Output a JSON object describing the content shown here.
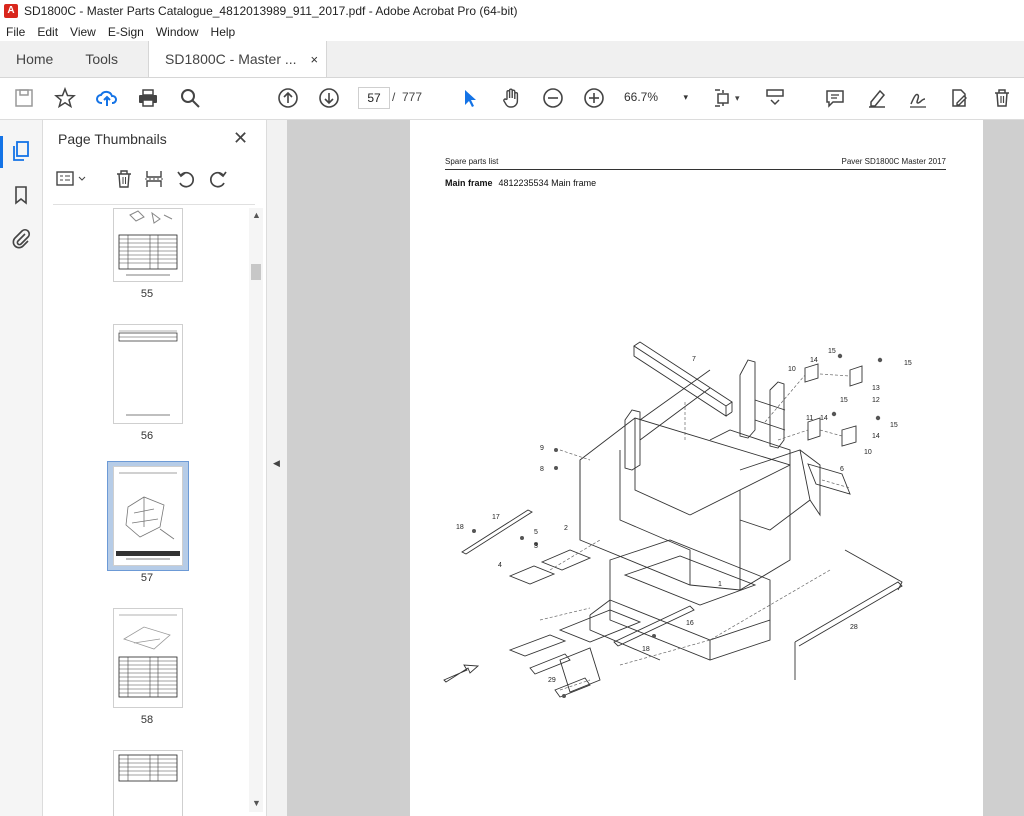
{
  "window": {
    "title": "SD1800C - Master Parts Catalogue_4812013989_911_2017.pdf - Adobe Acrobat Pro (64-bit)"
  },
  "menu": [
    "File",
    "Edit",
    "View",
    "E-Sign",
    "Window",
    "Help"
  ],
  "tabs": {
    "home": "Home",
    "tools": "Tools",
    "document": "SD1800C - Master ...",
    "close": "×"
  },
  "toolbar": {
    "page_current": "57",
    "page_separator": "/",
    "page_total": "777",
    "zoom": "66.7%"
  },
  "panel": {
    "title": "Page Thumbnails",
    "thumbnails": [
      {
        "label": "55"
      },
      {
        "label": "56"
      },
      {
        "label": "57"
      },
      {
        "label": "58"
      },
      {
        "label": ""
      }
    ]
  },
  "document_page": {
    "header_left": "Spare parts list",
    "header_right": "Paver SD1800C Master 2017",
    "subtitle_bold": "Main frame",
    "subtitle_rest": "4812235534 Main frame",
    "callouts": [
      "7",
      "14",
      "15",
      "15",
      "10",
      "13",
      "12",
      "14",
      "15",
      "11",
      "14",
      "15",
      "10",
      "9",
      "8",
      "6",
      "17",
      "18",
      "5",
      "2",
      "3",
      "4",
      "1",
      "16",
      "18",
      "28",
      "29"
    ]
  }
}
